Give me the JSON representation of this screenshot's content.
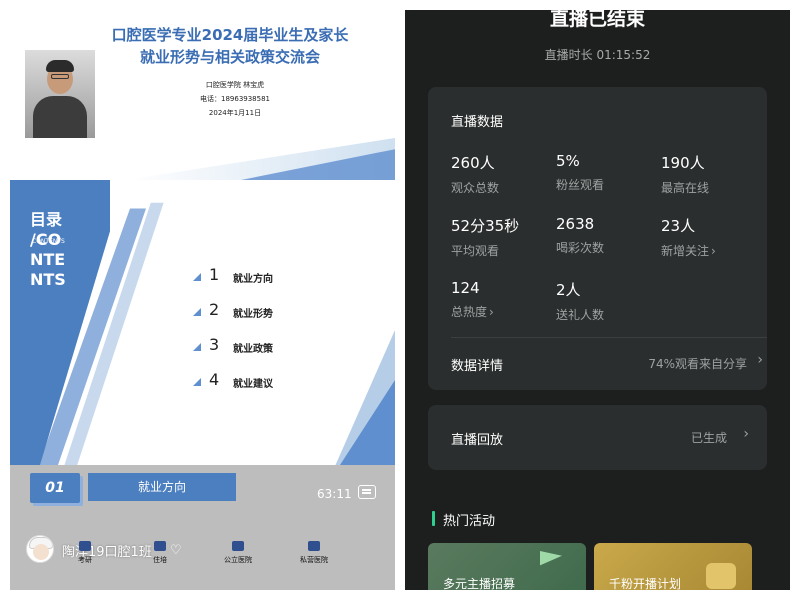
{
  "left": {
    "slide": {
      "title_line1": "口腔医学专业2024届毕业生及家长",
      "title_line2": "就业形势与相关政策交流会",
      "info_line1": "口腔医学院 林宝虎",
      "info_line2": "电话：18963938581",
      "info_line3": "2024年1月11日",
      "toc_title": "目录 /CO NTE NTS",
      "toc_sub": "CONTENTS",
      "toc_items": [
        {
          "num": "1",
          "label": "就业方向"
        },
        {
          "num": "2",
          "label": "就业形势"
        },
        {
          "num": "3",
          "label": "就业政策"
        },
        {
          "num": "4",
          "label": "就业建议"
        }
      ]
    },
    "section": {
      "num": "01",
      "label": "就业方向"
    },
    "duration": "63:11",
    "nav": [
      "考研",
      "住培",
      "公立医院",
      "私营医院"
    ],
    "host": {
      "name": "陶洋19口腔1班",
      "heart": "♡"
    }
  },
  "right": {
    "ended_title": "直播已结束",
    "duration_text": "直播时长 01:15:52",
    "stats": {
      "title": "直播数据",
      "items": [
        {
          "value": "260人",
          "label": "观众总数"
        },
        {
          "value": "5%",
          "label": "粉丝观看"
        },
        {
          "value": "190人",
          "label": "最高在线"
        },
        {
          "value": "52分35秒",
          "label": "平均观看"
        },
        {
          "value": "2638",
          "label": "喝彩次数"
        },
        {
          "value": "23人",
          "label": "新增关注"
        },
        {
          "value": "124",
          "label": "总热度"
        },
        {
          "value": "2人",
          "label": "送礼人数"
        }
      ],
      "details_label": "数据详情",
      "details_value": "74%观看来自分享"
    },
    "replay": {
      "label": "直播回放",
      "value": "已生成"
    },
    "hot": {
      "title": "热门活动",
      "activities": [
        "多元主播招募",
        "千粉开播计划"
      ]
    },
    "colors": {
      "background": "#1d1f1f",
      "card": "#2b2e2e",
      "accent": "#2fcf8f"
    }
  }
}
